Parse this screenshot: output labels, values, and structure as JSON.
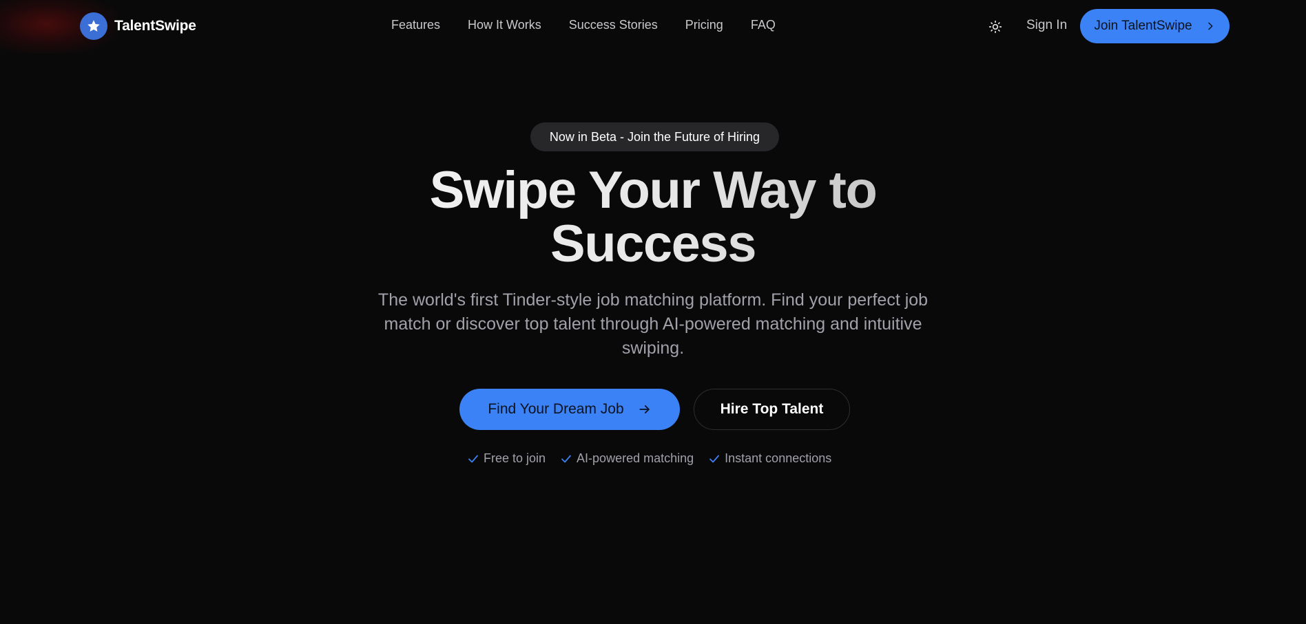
{
  "brand": {
    "name": "TalentSwipe",
    "logo_icon": "star-icon",
    "logo_color": "#3b6fd6"
  },
  "nav": {
    "links": [
      {
        "label": "Features"
      },
      {
        "label": "How It Works"
      },
      {
        "label": "Success Stories"
      },
      {
        "label": "Pricing"
      },
      {
        "label": "FAQ"
      }
    ]
  },
  "header_actions": {
    "theme_icon": "sun-icon",
    "sign_in": "Sign In",
    "join_label": "Join TalentSwipe",
    "join_icon": "chevron-right-icon"
  },
  "hero": {
    "badge": "Now in Beta - Join the Future of Hiring",
    "title_line1": "Swipe Your Way to",
    "title_line2": "Success",
    "subtitle": "The world's first Tinder-style job matching platform. Find your perfect job match or discover top talent through AI-powered matching and intuitive swiping.",
    "primary_cta": "Find Your Dream Job",
    "primary_cta_icon": "arrow-right-icon",
    "secondary_cta": "Hire Top Talent",
    "features": [
      {
        "label": "Free to join",
        "icon": "check-icon"
      },
      {
        "label": "AI-powered matching",
        "icon": "check-icon"
      },
      {
        "label": "Instant connections",
        "icon": "check-icon"
      }
    ]
  },
  "colors": {
    "background": "#09090a",
    "accent": "#3b82f6",
    "muted_text": "#a1a1aa",
    "pill_bg": "#27272a"
  }
}
